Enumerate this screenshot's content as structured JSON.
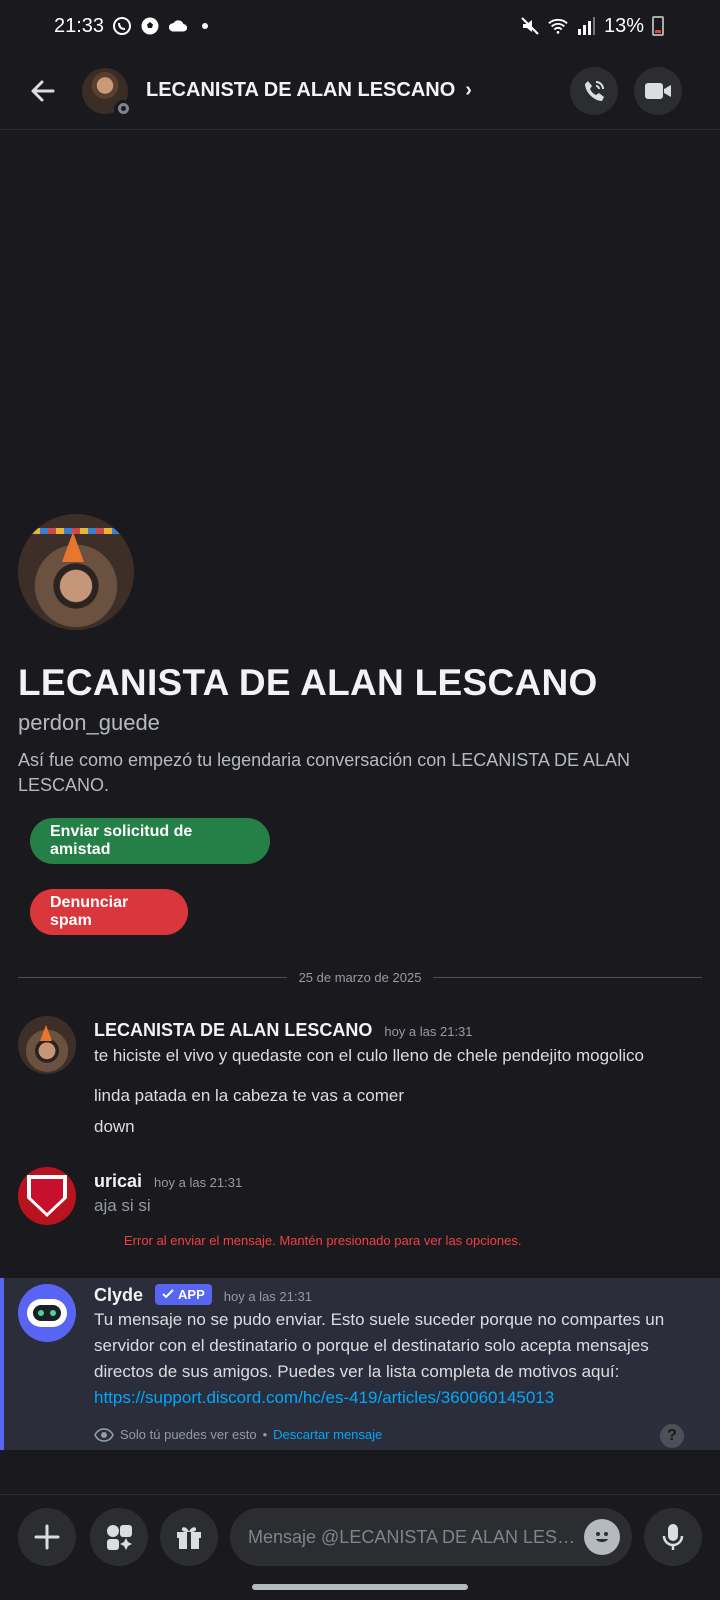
{
  "status_bar": {
    "time": "21:33",
    "battery_percent": "13%",
    "left_icons": [
      "whatsapp-icon",
      "soccer-icon",
      "cloud-icon",
      "notification-dot"
    ],
    "right_icons": [
      "mute-icon",
      "wifi-icon",
      "signal-icon",
      "battery-icon"
    ]
  },
  "header": {
    "title": "LECANISTA DE ALAN LESCANO",
    "chevron": "›",
    "actions": [
      "voice-call-icon",
      "video-call-icon"
    ]
  },
  "profile": {
    "display_name": "LECANISTA DE ALAN LESCANO",
    "username": "perdon_guede",
    "description": "Así fue como empezó tu legendaria conversación con LECANISTA DE ALAN LESCANO.",
    "friend_button": "Enviar solicitud de amistad",
    "spam_button": "Denunciar spam"
  },
  "date_divider": "25 de marzo de 2025",
  "messages": [
    {
      "author": "LECANISTA DE ALAN LESCANO",
      "time": "hoy a las 21:31",
      "lines": [
        "te hiciste el vivo y quedaste con el culo lleno de chele pendejito mogolico",
        "linda patada en la cabeza te vas a comer",
        "down"
      ]
    },
    {
      "author": "uricai",
      "time": "hoy a las 21:31",
      "lines": [
        "aja si si"
      ],
      "error": "Error al enviar el mensaje. Mantén presionado para ver las opciones."
    }
  ],
  "clyde": {
    "author": "Clyde",
    "badge": "APP",
    "time": "hoy a las 21:31",
    "body": "Tu mensaje no se pudo enviar. Esto suele suceder porque no compartes un servidor con el destinatario o porque el destinatario solo acepta mensajes directos de sus amigos. Puedes ver la lista completa de motivos aquí:",
    "link": "https://support.discord.com/hc/es-419/articles/360060145013",
    "only_you": "Solo tú puedes ver esto",
    "separator": "•",
    "dismiss": "Descartar mensaje",
    "help": "?"
  },
  "composer": {
    "placeholder": "Mensaje @LECANISTA DE ALAN LESC..."
  },
  "colors": {
    "background": "#1a1a1e",
    "friend_button": "#248046",
    "spam_button": "#da373c",
    "accent": "#5865f2",
    "link": "#00a8fc",
    "error": "#f23f43"
  }
}
